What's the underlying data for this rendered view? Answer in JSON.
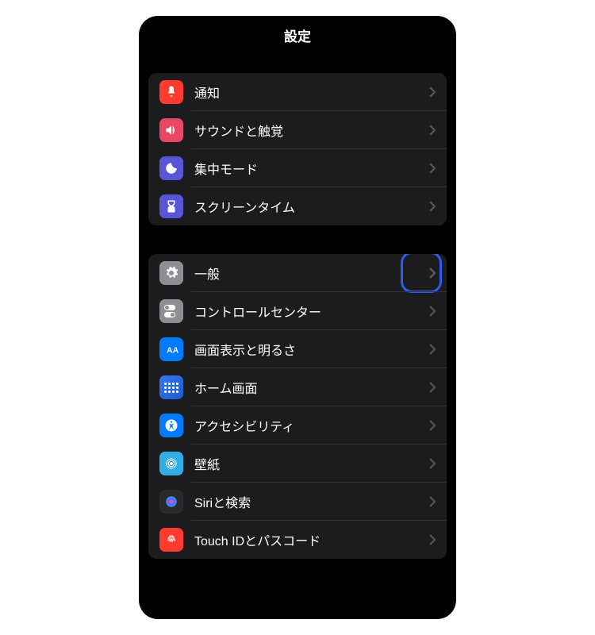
{
  "header": {
    "title": "設定"
  },
  "group1": {
    "items": [
      {
        "label": "通知",
        "icon": "notifications-icon",
        "bg": "bg-red"
      },
      {
        "label": "サウンドと触覚",
        "icon": "sound-icon",
        "bg": "bg-pink"
      },
      {
        "label": "集中モード",
        "icon": "focus-icon",
        "bg": "bg-purple"
      },
      {
        "label": "スクリーンタイム",
        "icon": "screentime-icon",
        "bg": "bg-screentime"
      }
    ]
  },
  "group2": {
    "items": [
      {
        "label": "一般",
        "icon": "general-icon",
        "bg": "bg-gray",
        "highlighted": true
      },
      {
        "label": "コントロールセンター",
        "icon": "control-center-icon",
        "bg": "bg-gray"
      },
      {
        "label": "画面表示と明るさ",
        "icon": "display-icon",
        "bg": "bg-blue"
      },
      {
        "label": "ホーム画面",
        "icon": "home-screen-icon",
        "bg": "bg-gradient-blue"
      },
      {
        "label": "アクセシビリティ",
        "icon": "accessibility-icon",
        "bg": "bg-blue"
      },
      {
        "label": "壁紙",
        "icon": "wallpaper-icon",
        "bg": "bg-cyan"
      },
      {
        "label": "Siriと検索",
        "icon": "siri-icon",
        "bg": "bg-dark"
      },
      {
        "label": "Touch IDとパスコード",
        "icon": "fingerprint-icon",
        "bg": "bg-fingerprint"
      }
    ]
  }
}
